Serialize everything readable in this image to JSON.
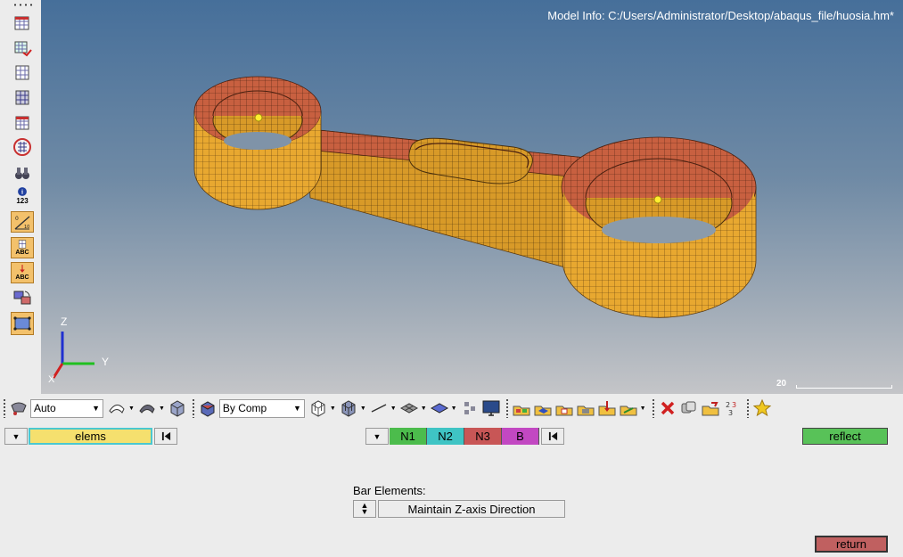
{
  "left_toolbar": {
    "tools": [
      {
        "icon": "component-table-icon"
      },
      {
        "icon": "mask-icon"
      },
      {
        "icon": "unmask-icon"
      },
      {
        "icon": "show-mesh-icon"
      },
      {
        "icon": "isolate-icon"
      },
      {
        "icon": "find-icon"
      },
      {
        "icon": "binoculars-icon"
      },
      {
        "icon": "info-icon",
        "label": "123"
      },
      {
        "icon": "measure-icon"
      },
      {
        "icon": "label-abc-icon",
        "label": "ABC"
      },
      {
        "icon": "label-abc-red-icon",
        "label": "ABC"
      },
      {
        "icon": "rotate-icon"
      },
      {
        "icon": "fit-view-icon"
      }
    ]
  },
  "viewport": {
    "model_info": "Model Info: C:/Users/Administrator/Desktop/abaqus_file/huosia.hm*",
    "axis_z": "Z",
    "axis_y": "Y",
    "axis_x": "X",
    "scale_label": "20"
  },
  "toolbar": {
    "render_mode": "Auto",
    "color_mode": "By Comp"
  },
  "panel": {
    "elems_label": "elems",
    "nodes": [
      {
        "label": "N1",
        "color": "#4cbc4c"
      },
      {
        "label": "N2",
        "color": "#3fc4c4"
      },
      {
        "label": "N3",
        "color": "#c85656"
      },
      {
        "label": "B",
        "color": "#c248c2"
      }
    ],
    "reflect_label": "reflect",
    "bar_elements_label": "Bar Elements:",
    "orientation_option": "Maintain Z-axis Direction",
    "return_label": "return"
  },
  "colors": {
    "mesh_yellow": "#e8a830",
    "mesh_red": "#c86040",
    "collector_yellow": "#f5e06e",
    "reflect_green": "#58c258",
    "return_red": "#c06060"
  }
}
